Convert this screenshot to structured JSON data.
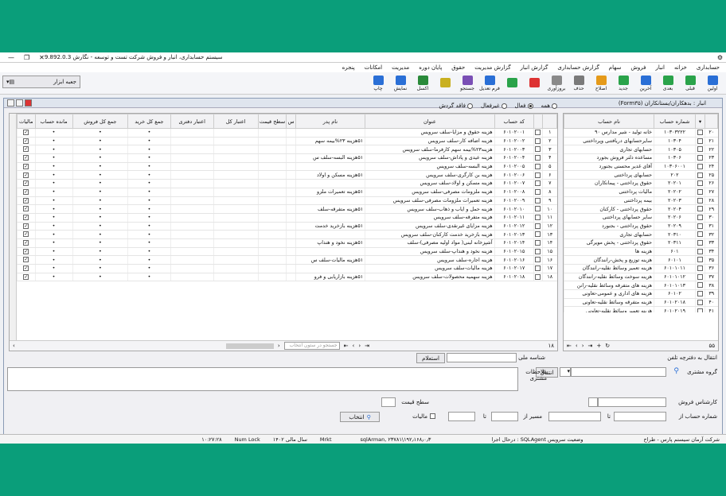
{
  "app": {
    "title": "سیستم حسابداری، انبار و فروش شرکت تست و توسعه - نگارش 9.892.0.3"
  },
  "menu": [
    "حسابداری",
    "خزانه",
    "انبار",
    "فروش",
    "سهام",
    "گزارش حسابداری",
    "گزارش انبار",
    "گزارش مدیریت",
    "حقوق",
    "پایان دوره",
    "مدیریت",
    "امکانات",
    "پنجره"
  ],
  "toolbar": [
    {
      "label": "اولین",
      "color": "#2a6fd6"
    },
    {
      "label": "قبلی",
      "color": "#2aa34a"
    },
    {
      "label": "بعدی",
      "color": "#2aa34a"
    },
    {
      "label": "آخرین",
      "color": "#2a6fd6"
    },
    {
      "label": "جدید",
      "color": "#2aa34a"
    },
    {
      "label": "اصلاح",
      "color": "#e59a1a"
    },
    {
      "label": "حذف",
      "color": "#7a7a7a"
    },
    {
      "label": "بروزآوری",
      "color": "#8a8a8a"
    },
    {
      "label": "",
      "color": "#d33"
    },
    {
      "label": "",
      "color": "#2aa34a"
    },
    {
      "label": "فرم تعدیل",
      "color": "#2a6fd6"
    },
    {
      "label": "جستجو",
      "color": "#7a4fb5"
    },
    {
      "label": "",
      "color": "#c9b020"
    },
    {
      "label": "اکسل",
      "color": "#2a8a3a"
    },
    {
      "label": "نمایش",
      "color": "#2a6fd6"
    },
    {
      "label": "چاپ",
      "color": "#2a6fd6"
    }
  ],
  "toolbox": {
    "label": "جعبه ابزار"
  },
  "inner": {
    "title": "انبار : بدهکاران/بستانکاران (Form۳۵)"
  },
  "right_table": {
    "headers": [
      "شماره حساب",
      "نام حساب"
    ],
    "rows": [
      [
        "۲۰",
        "۱۰۳۰۳۲۲۲",
        "خانه تولید - شیر مدارس ۹۰"
      ],
      [
        "۲۱",
        "۱۰۳۰۴",
        "سایرحسابهای دریافتنی وپرداختنی"
      ],
      [
        "۲۲",
        "۱۰۳۰۵",
        "حسابهای تجاری"
      ],
      [
        "۲۳",
        "۱۰۳۰۶",
        "مساعده دلتر فروش بجورد"
      ],
      [
        "۲۴",
        "۱۰۳۰۶۰۰۱",
        "آقای غدیر محسنی بجنورد"
      ],
      [
        "۲۵",
        "۲۰۲",
        "حسابهای پرداختنی"
      ],
      [
        "۲۶",
        "۲۰۲۰۱",
        "حقوق پرداختنی - پیمانکاران"
      ],
      [
        "۲۷",
        "۲۰۲۰۲",
        "مالیات پرداختنی"
      ],
      [
        "۲۸",
        "۲۰۲۰۳",
        "بیمه پرداختنی"
      ],
      [
        "۲۹",
        "۲۰۲۰۴",
        "حقوق پرداختنی - کارکنان"
      ],
      [
        "۳۰",
        "۲۰۲۰۶",
        "سایر حسابهای پرداختنی"
      ],
      [
        "۳۱",
        "۲۰۲۰۹",
        "حقوق پرداختنی - بجنورد"
      ],
      [
        "۳۲",
        "۲۰۳۱۰",
        "حسابهای تجاری"
      ],
      [
        "۳۳",
        "۲۰۳۱۱",
        "حقوق پرداختنی - پخش مویرگی"
      ],
      [
        "۳۴",
        "۶۰۱",
        "هزینه ها"
      ],
      [
        "۳۵",
        "۶۰۱۰۱",
        "هزینه توزیع و پخش-رانندگان"
      ],
      [
        "۳۶",
        "۶۰۱۰۱۰۱۱",
        "هزینه تعمیر وسائط نقلیه-رانندگان"
      ],
      [
        "۳۷",
        "۶۰۱۰۱۰۱۲",
        "هزینه سوخت وسائط نقلیه-رانندگان"
      ],
      [
        "۳۸",
        "۶۰۱۰۱۰۱۳",
        "هزینه های متفرقه وسائط نقلیه-رانن"
      ],
      [
        "۳۹",
        "۶۰۱۰۲",
        "هزینه های اداری و عمومی-تعاونی"
      ],
      [
        "۴۰",
        "۶۰۱۰۲۰۱۸",
        "هزینه متفرقه وسائط نقلیه-تعاونی"
      ],
      [
        "۴۱",
        "۶۰۱۰۲۰۱۹",
        "هزینه تعمیر وسائط نقلیه-تعاونی"
      ],
      [
        "۴۲",
        "۶۰۱۰۲۰۲۰",
        "هزینه سوخت وسائط نقلیه-تعاونی"
      ],
      [
        "۴۳",
        "۶۰۱۰۲",
        "هزینه سلف سرویس-آشپزخانه"
      ]
    ],
    "count": "۵۵"
  },
  "filters": {
    "all": "همه",
    "active": "فعال",
    "inactive": "غیرفعال",
    "no_turnover": "فاقد گردش"
  },
  "left_table": {
    "headers": [
      "کد حساب",
      "عنوان",
      "نام پدر",
      "س",
      "سطح قیمت",
      "اعتبار کل",
      "اعتبار دفتری",
      "جمع کل خرید",
      "جمع کل فروش",
      "مانده حساب",
      "مالیات"
    ],
    "rows": [
      [
        "۱",
        "۶۰۱۰۲۰۰۱",
        "هزینه حقوق و مزایا-سلف سرویس",
        ""
      ],
      [
        "۲",
        "۶۰۱۰۲۰۰۲",
        "هزینه اضافه کار-سلف سرویس",
        "۵۱هزینه ۲۳%بیمه سهم"
      ],
      [
        "۳",
        "۶۰۱۰۲۰۰۳",
        "هزینه۲۳%بیمه سهم کارفرما-سلف سرویس",
        ""
      ],
      [
        "۴",
        "۶۰۱۰۲۰۰۴",
        "هزینه عیدی و پاداش-سلف سرویس",
        "۵۱هزینه البسه-سلف س"
      ],
      [
        "۵",
        "۶۰۱۰۲۰۰۵",
        "هزینه البسه-سلف سرویس",
        ""
      ],
      [
        "۶",
        "۶۰۱۰۲۰۰۶",
        "هزینه بن کارگری-سلف سرویس",
        "۵۱هزینه مسکن و اولاد"
      ],
      [
        "۷",
        "۶۰۱۰۲۰۰۷",
        "هزینه مسکن و اولاد-سلف سرویس",
        ""
      ],
      [
        "۸",
        "۶۰۱۰۲۰۰۸",
        "هزینه ملزومات مصرفی-سلف سرویس",
        "۵۱هزینه تعمیرات ملزو"
      ],
      [
        "۹",
        "۶۰۱۰۲۰۰۹",
        "هزینه تعمیرات ملزومات مصرفی-سلف سرویس",
        ""
      ],
      [
        "۱۰",
        "۶۰۱۰۲۰۱۰",
        "هزینه حمل و ایاب و ذهاب-سلف سرویس",
        "۵۱هزینه متفرقه-سلف"
      ],
      [
        "۱۱",
        "۶۰۱۰۲۰۱۱",
        "هزینه متفرقه-سلف سرویس",
        ""
      ],
      [
        "۱۲",
        "۶۰۱۰۲۰۱۲",
        "هزینه مزایای غیرنقدی-سلف سرویس",
        "۵۱هزینه بازخرید خدمت"
      ],
      [
        "۱۳",
        "۶۰۱۰۲۰۱۳",
        "هزینه بازخرید خدمت کارکنان-سلف سرویس",
        ""
      ],
      [
        "۱۴",
        "۶۰۱۰۲۰۱۴",
        "آشپزخانه لبنی( مواد اولیه مصرفی)-سلف",
        "۵۱هزینه نخود و هنداپ"
      ],
      [
        "۱۵",
        "۶۰۱۰۲۰۱۵",
        "هزینه نخود و هنداپ-سلف سرویس",
        ""
      ],
      [
        "۱۶",
        "۶۰۱۰۲۰۱۶",
        "هزینه اجاره-سلف سرویس",
        "۵۱هزینه مالیات-سلف س"
      ],
      [
        "۱۷",
        "۶۰۱۰۲۰۱۷",
        "هزینه مالیات-سلف سرویس",
        ""
      ],
      [
        "۱۸",
        "۶۰۱۰۲۰۱۸",
        "هزینه سهمیه محصولات-سلف سرویس",
        "۵۱هزینه بازاریابی و فرو"
      ]
    ],
    "count": "۱۸",
    "search_placeholder": "جستجو در ستون انتخاب"
  },
  "form": {
    "transfer_ledger": "انتقال به دفترچه تلفن",
    "customer_group": "گروه مشتری",
    "transfer_btn": "انتقال",
    "code_label": "شناسه ملی",
    "inquiry_btn": "استعلام",
    "customer_notes": "ملاحظات مشتری",
    "sales_expert": "کارشناس فروش",
    "price_level": "سطح قیمت",
    "account_from": "شماره حساب از",
    "to": "تا",
    "path_from": "مسیر از",
    "to2": "تا",
    "tax": "مالیات",
    "select_btn": "انتخاب"
  },
  "status": {
    "company": "شرکت آرمان سیستم پارس - طراح",
    "sql": "وضعیت سرویس SQLAgent : درحال اجرا",
    "server": "۱۹۲٫۱۶۸٫۰٫۳\\sqlArman, ۲۳۷۸۱",
    "mrkt": "Mrkt",
    "year": "سال مالی ۱۴۰۲",
    "numlock": "Num Lock",
    "time": "۱۰:۲۷:۲۸"
  }
}
